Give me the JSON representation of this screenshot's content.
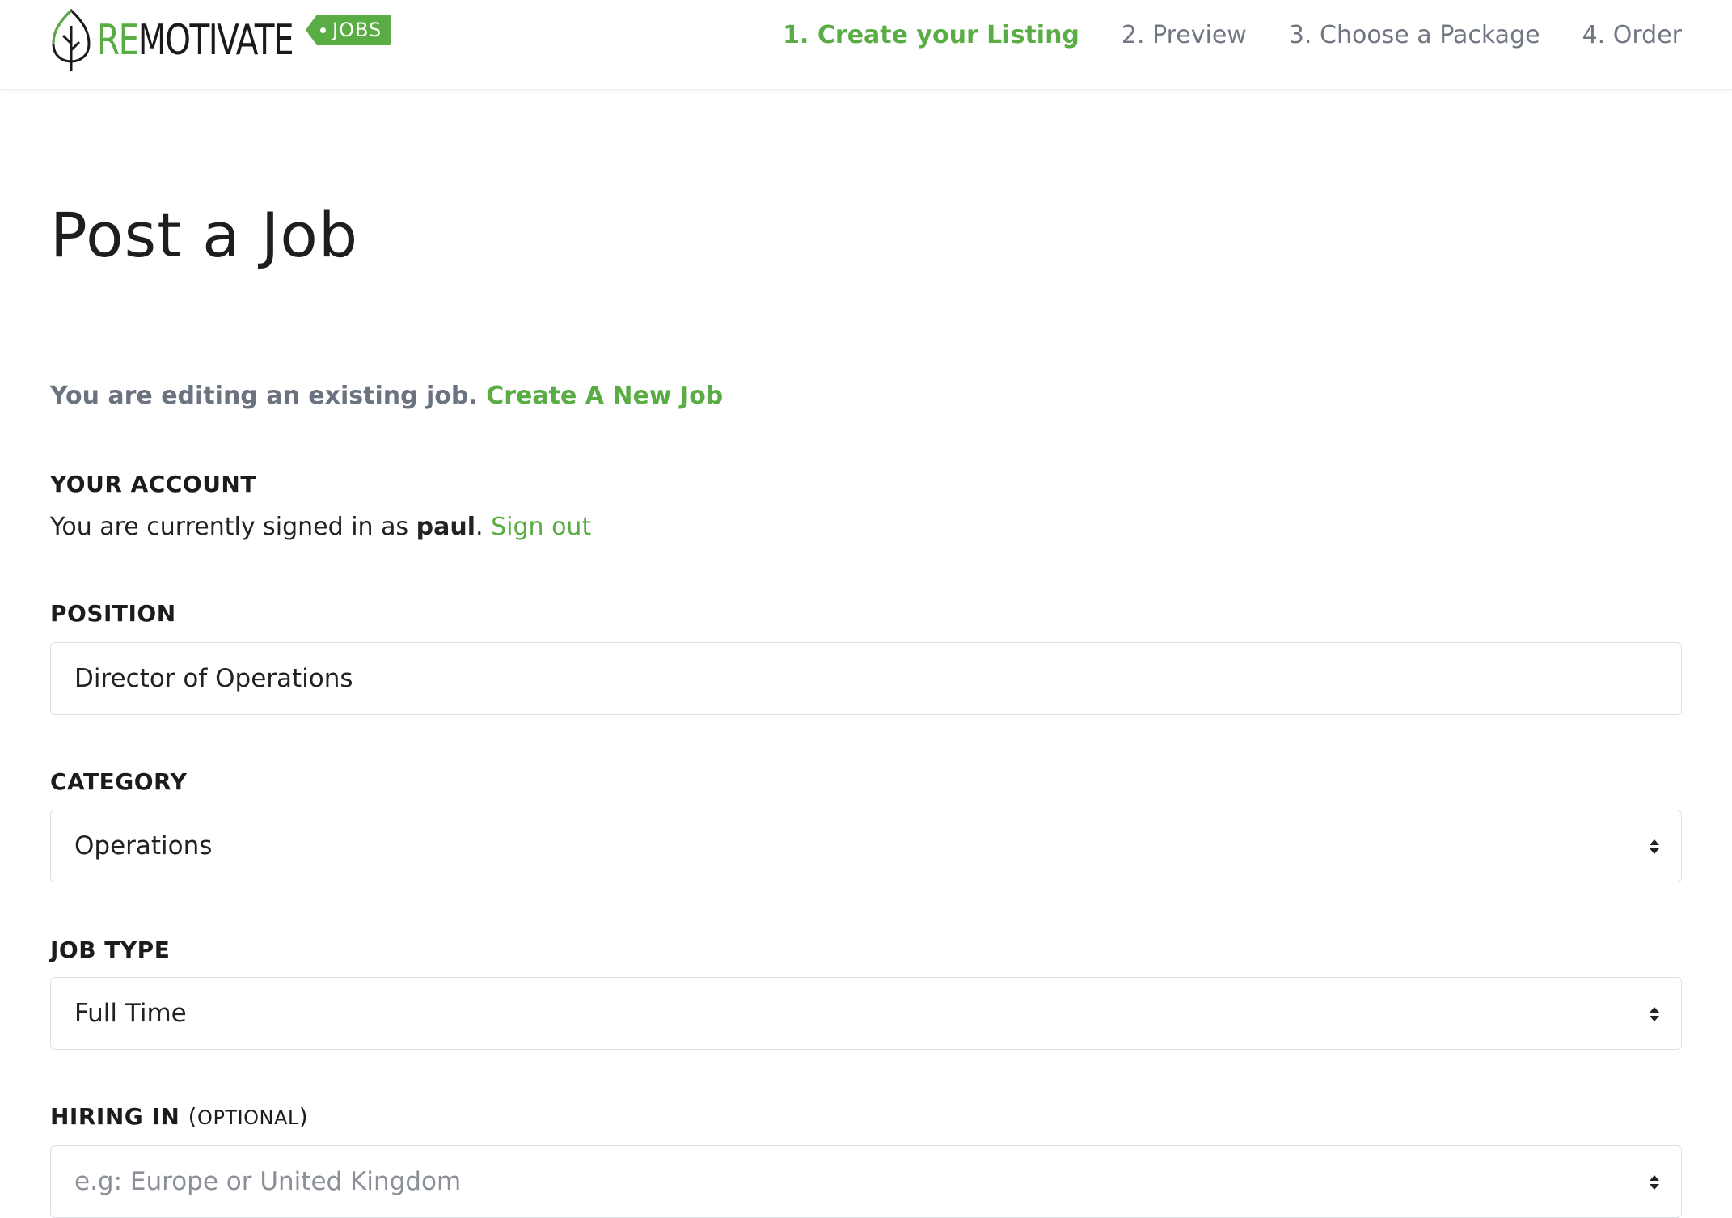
{
  "brand": {
    "name_prefix": "RE",
    "name_rest": "MOTIVATE",
    "tag": "JOBS",
    "colors": {
      "accent": "#5aac45",
      "text": "#1a1a1a",
      "muted": "#707782"
    }
  },
  "steps": [
    {
      "label": "1. Create your Listing",
      "active": true
    },
    {
      "label": "2. Preview",
      "active": false
    },
    {
      "label": "3. Choose a Package",
      "active": false
    },
    {
      "label": "4. Order",
      "active": false
    }
  ],
  "page": {
    "title": "Post a Job",
    "editing_note": "You are editing an existing job.",
    "create_new_link": "Create A New Job"
  },
  "account": {
    "heading": "YOUR ACCOUNT",
    "signed_in_prefix": "You are currently signed in as",
    "username": "paul",
    "period": ".",
    "sign_out_label": "Sign out"
  },
  "form": {
    "position": {
      "label": "POSITION",
      "value": "Director of Operations"
    },
    "category": {
      "label": "CATEGORY",
      "value": "Operations",
      "icon": "select-arrows-icon"
    },
    "job_type": {
      "label": "JOB TYPE",
      "value": "Full Time",
      "icon": "select-arrows-icon"
    },
    "hiring_in": {
      "label": "HIRING IN",
      "optional_open": "(",
      "optional_text": "OPTIONAL",
      "optional_close": ")",
      "placeholder": "e.g: Europe or United Kingdom",
      "icon": "select-arrows-icon"
    }
  }
}
